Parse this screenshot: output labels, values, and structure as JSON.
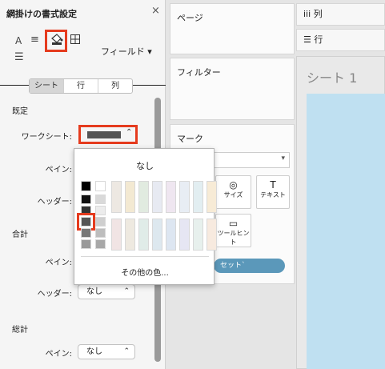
{
  "format_pane": {
    "title": "網掛けの書式設定",
    "close_icon": "×",
    "field_button": "フィールド ▾",
    "tabs": [
      "シート",
      "行",
      "列"
    ],
    "sections": {
      "default": {
        "heading": "既定",
        "worksheet_label": "ワークシート:",
        "pane_label": "ペイン:",
        "header_label": "ヘッダー:"
      },
      "total": {
        "heading": "合計",
        "pane_label": "ペイン:",
        "header_label": "ヘッダー:",
        "header_value": "なし"
      },
      "grand_total": {
        "heading": "総計",
        "pane_label": "ペイン:",
        "pane_value": "なし"
      }
    },
    "worksheet_color": "#555555"
  },
  "color_popup": {
    "none_label": "なし",
    "more_colors_label": "その他の色...",
    "selected_color": "#555555",
    "grays_top": [
      "#000000",
      "#ffffff"
    ],
    "grays_mid": [
      "#111111",
      "#d9d9d9",
      "#333333",
      "#ececec",
      "#555555",
      "#cfcfcf",
      "#777777",
      "#bdbdbd",
      "#999999",
      "#a8a8a8"
    ],
    "pastels": [
      "#ede8e2",
      "#f3e9d2",
      "#e1ebe0",
      "#e7eaf2",
      "#efe6f0",
      "#e8edf4",
      "#e2eef1",
      "#f7ebd6"
    ],
    "pastels_2": [
      "#f1e4e4",
      "#eee9e0",
      "#e0ece8",
      "#dde8ef",
      "#dde6f1",
      "#e6e6f3",
      "#e7f0ed",
      "#f7eadf"
    ]
  },
  "shelves": {
    "pages": "ページ",
    "filters": "フィルター",
    "marks": "マーク",
    "columns_icon": "iii",
    "columns": "列",
    "rows_icon": "☰",
    "rows": "行",
    "size": "サイズ",
    "text": "テキスト",
    "tooltip": "ツールヒント",
    "set": "セット`"
  },
  "sheet": {
    "title": "シート 1"
  }
}
